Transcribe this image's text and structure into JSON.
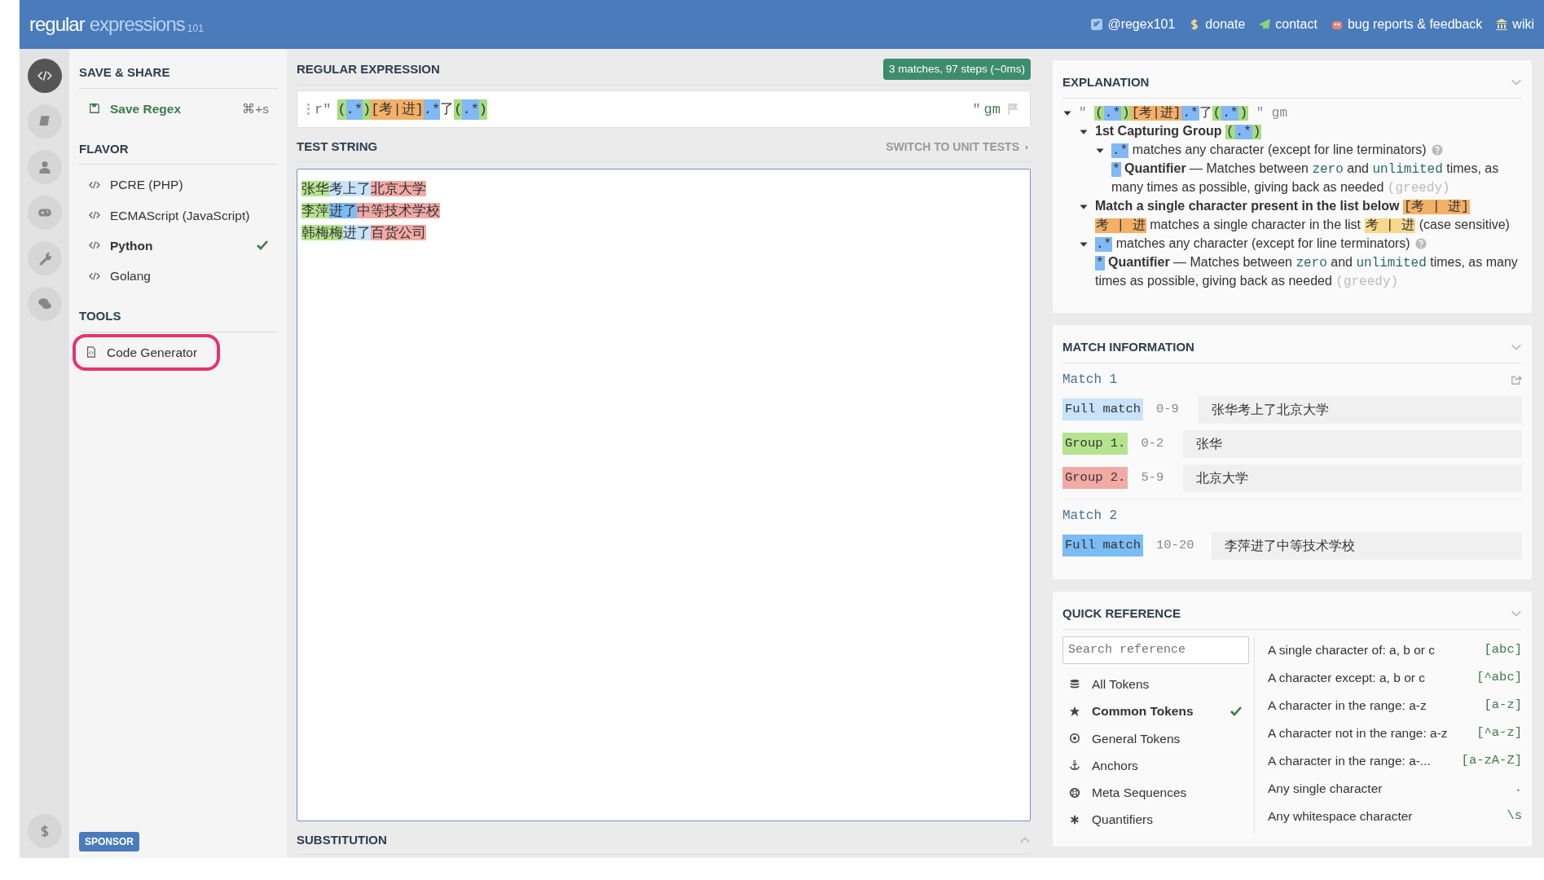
{
  "header": {
    "logo": {
      "word1": "regular",
      "word2": "expressions",
      "version": "101"
    },
    "links": [
      {
        "label": "@regex101"
      },
      {
        "label": "donate"
      },
      {
        "label": "contact"
      },
      {
        "label": "bug reports & feedback"
      },
      {
        "label": "wiki"
      }
    ]
  },
  "rail": [
    {
      "selected": true
    },
    {
      "selected": false
    },
    {
      "selected": false
    },
    {
      "selected": false
    },
    {
      "selected": false
    },
    {
      "selected": false
    }
  ],
  "sidebar": {
    "sections": [
      {
        "title": "SAVE & SHARE",
        "items": [
          {
            "label": "Save Regex",
            "kind": "action",
            "shortcut": "⌘+s"
          }
        ]
      },
      {
        "title": "FLAVOR",
        "items": [
          {
            "label": "PCRE (PHP)",
            "kind": "flavor",
            "selected": false
          },
          {
            "label": "ECMAScript (JavaScript)",
            "kind": "flavor",
            "selected": false
          },
          {
            "label": "Python",
            "kind": "flavor",
            "selected": true
          },
          {
            "label": "Golang",
            "kind": "flavor",
            "selected": false
          }
        ]
      },
      {
        "title": "TOOLS",
        "items": [
          {
            "label": "Code Generator",
            "kind": "tool",
            "circled": true
          }
        ]
      }
    ],
    "sponsor": "SPONSOR"
  },
  "regex": {
    "title": "REGULAR EXPRESSION",
    "status": "3 matches, 97 steps (~0ms)",
    "prefix": "r\"",
    "suffix": "\"",
    "flags": "gm",
    "tokens": [
      {
        "text": "(",
        "kind": "grp"
      },
      {
        "text": ".*",
        "kind": "dot"
      },
      {
        "text": ")",
        "kind": "grp"
      },
      {
        "text": "[考|进]",
        "kind": "cls"
      },
      {
        "text": ".*",
        "kind": "dot"
      },
      {
        "text": "了",
        "kind": "text"
      },
      {
        "text": "(",
        "kind": "grp"
      },
      {
        "text": ".*",
        "kind": "dot"
      },
      {
        "text": ")",
        "kind": "grp"
      }
    ]
  },
  "test_string": {
    "title": "TEST STRING",
    "switch": "SWITCH TO UNIT TESTS",
    "lines": [
      [
        {
          "text": "张华",
          "kind": "group1"
        },
        {
          "text": "考上了",
          "kind": "full"
        },
        {
          "text": "北京大学",
          "kind": "group2"
        }
      ],
      [
        {
          "text": "李萍",
          "kind": "group1"
        },
        {
          "text": "进了",
          "kind": "full-alt"
        },
        {
          "text": "中等技术学校",
          "kind": "group2"
        }
      ],
      [
        {
          "text": "韩梅梅",
          "kind": "group1"
        },
        {
          "text": "进了",
          "kind": "full"
        },
        {
          "text": "百货公司",
          "kind": "group2"
        }
      ]
    ]
  },
  "substitution": {
    "title": "SUBSTITUTION",
    "expanded": false
  },
  "explanation": {
    "title": "EXPLANATION",
    "expanded": true,
    "tree": [
      {
        "expanded": true,
        "parts": [
          {
            "text": "\" ",
            "kind": "quote"
          },
          {
            "text": "(",
            "kind": "grp"
          },
          {
            "text": ".*",
            "kind": "dot"
          },
          {
            "text": ")",
            "kind": "grp"
          },
          {
            "text": "[考|进]",
            "kind": "cls"
          },
          {
            "text": ".*",
            "kind": "dot"
          },
          {
            "text": "了",
            "kind": "text"
          },
          {
            "text": "(",
            "kind": "grp"
          },
          {
            "text": ".*",
            "kind": "dot"
          },
          {
            "text": ")",
            "kind": "grp"
          },
          {
            "text": " \" gm",
            "kind": "quote"
          }
        ],
        "children": [
          {
            "expanded": true,
            "parts": [
              {
                "text": "1st Capturing Group ",
                "kind": "bold"
              },
              {
                "text": "(",
                "kind": "grp"
              },
              {
                "text": ".*",
                "kind": "dot"
              },
              {
                "text": ")",
                "kind": "grp"
              }
            ],
            "children": [
              {
                "expanded": true,
                "help": true,
                "parts": [
                  {
                    "text": ".*",
                    "kind": "dot"
                  },
                  {
                    "text": " matches any character (except for line terminators)",
                    "kind": "text"
                  }
                ],
                "children": [
                  {
                    "parts": [
                      {
                        "text": "*",
                        "kind": "dot"
                      },
                      {
                        "text": " Quantifier",
                        "kind": "bold"
                      },
                      {
                        "text": " — Matches between ",
                        "kind": "text"
                      },
                      {
                        "text": "zero",
                        "kind": "code"
                      },
                      {
                        "text": " and ",
                        "kind": "text"
                      },
                      {
                        "text": "unlimited",
                        "kind": "code"
                      },
                      {
                        "text": " times, as many times as possible, giving back as needed ",
                        "kind": "text"
                      },
                      {
                        "text": "(greedy)",
                        "kind": "muted"
                      }
                    ]
                  }
                ]
              }
            ]
          },
          {
            "expanded": true,
            "parts": [
              {
                "text": "Match a single character present in the list below ",
                "kind": "bold"
              },
              {
                "text": "[考 | 进]",
                "kind": "cls"
              }
            ],
            "children": [
              {
                "parts": [
                  {
                    "text": "考 | 进",
                    "kind": "cls"
                  },
                  {
                    "text": " matches a single character in the list ",
                    "kind": "text"
                  },
                  {
                    "text": "考 | 进",
                    "kind": "clsin"
                  },
                  {
                    "text": " (case sensitive)",
                    "kind": "text"
                  }
                ]
              }
            ]
          },
          {
            "expanded": true,
            "help": true,
            "parts": [
              {
                "text": ".*",
                "kind": "dot"
              },
              {
                "text": " matches any character (except for line terminators)",
                "kind": "text"
              }
            ],
            "children": [
              {
                "parts": [
                  {
                    "text": "*",
                    "kind": "dot"
                  },
                  {
                    "text": " Quantifier",
                    "kind": "bold"
                  },
                  {
                    "text": " — Matches between ",
                    "kind": "text"
                  },
                  {
                    "text": "zero",
                    "kind": "code"
                  },
                  {
                    "text": " and ",
                    "kind": "text"
                  },
                  {
                    "text": "unlimited",
                    "kind": "code"
                  },
                  {
                    "text": " times, as many times as possible, giving back as needed ",
                    "kind": "text"
                  },
                  {
                    "text": "(greedy)",
                    "kind": "muted"
                  }
                ]
              }
            ]
          }
        ]
      }
    ]
  },
  "match_information": {
    "title": "MATCH INFORMATION",
    "expanded": true,
    "matches": [
      {
        "title": "Match 1",
        "rows": [
          {
            "label": "Full match",
            "kind": "full",
            "range": "0-9",
            "value": "张华考上了北京大学"
          },
          {
            "label": "Group 1.",
            "kind": "group1",
            "range": "0-2",
            "value": "张华"
          },
          {
            "label": "Group 2.",
            "kind": "group2",
            "range": "5-9",
            "value": "北京大学"
          }
        ]
      },
      {
        "title": "Match 2",
        "rows": [
          {
            "label": "Full match",
            "kind": "full-alt",
            "range": "10-20",
            "value": "李萍进了中等技术学校"
          }
        ]
      }
    ]
  },
  "quick_reference": {
    "title": "QUICK REFERENCE",
    "expanded": true,
    "search": {
      "placeholder": "Search reference"
    },
    "categories": [
      {
        "label": "All Tokens",
        "selected": false
      },
      {
        "label": "Common Tokens",
        "selected": true
      },
      {
        "label": "General Tokens",
        "selected": false
      },
      {
        "label": "Anchors",
        "selected": false
      },
      {
        "label": "Meta Sequences",
        "selected": false
      },
      {
        "label": "Quantifiers",
        "selected": false
      }
    ],
    "tokens": [
      {
        "description": "A single character of: a, b or c",
        "token": "[abc]"
      },
      {
        "description": "A character except: a, b or c",
        "token": "[^abc]"
      },
      {
        "description": "A character in the range: a-z",
        "token": "[a-z]"
      },
      {
        "description": "A character not in the range: a-z",
        "token": "[^a-z]"
      },
      {
        "description": "A character in the range: a-...",
        "token": "[a-zA-Z]"
      },
      {
        "description": "Any single character",
        "token": "."
      },
      {
        "description": "Any whitespace character",
        "token": "\\s"
      }
    ]
  }
}
